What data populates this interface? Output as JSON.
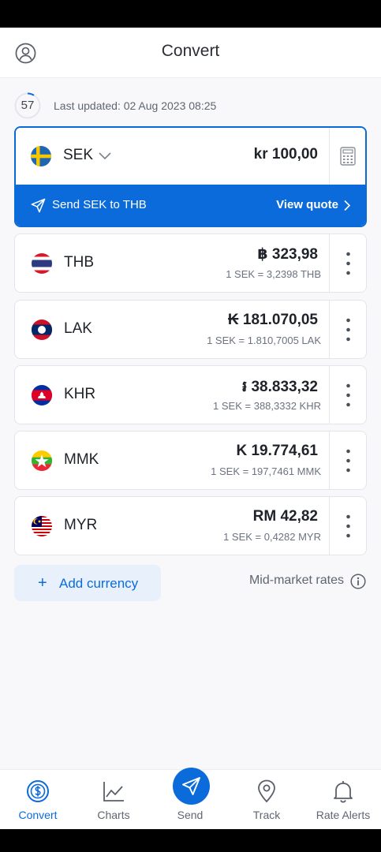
{
  "header": {
    "title": "Convert",
    "profile_icon": "user-circle-icon"
  },
  "status": {
    "timer": "57",
    "last_updated": "Last updated: 02 Aug 2023 08:25"
  },
  "base": {
    "code": "SEK",
    "amount": "kr 100,00",
    "send_text": "Send SEK to THB",
    "view_quote": "View quote"
  },
  "currencies": [
    {
      "code": "THB",
      "amount": "฿ 323,98",
      "rate": "1 SEK = 3,2398 THB"
    },
    {
      "code": "LAK",
      "amount": "₭ 181.070,05",
      "rate": "1 SEK = 1.810,7005 LAK"
    },
    {
      "code": "KHR",
      "amount": "៛ 38.833,32",
      "rate": "1 SEK = 388,3332 KHR"
    },
    {
      "code": "MMK",
      "amount": "K 19.774,61",
      "rate": "1 SEK = 197,7461 MMK"
    },
    {
      "code": "MYR",
      "amount": "RM 42,82",
      "rate": "1 SEK = 0,4282 MYR"
    }
  ],
  "actions": {
    "add_currency": "Add currency",
    "mid_market": "Mid-market rates"
  },
  "nav": [
    {
      "label": "Convert",
      "icon": "currency-icon",
      "active": true
    },
    {
      "label": "Charts",
      "icon": "chart-icon"
    },
    {
      "label": "Send",
      "icon": "send-icon"
    },
    {
      "label": "Track",
      "icon": "location-pin-icon"
    },
    {
      "label": "Rate Alerts",
      "icon": "bell-icon"
    }
  ],
  "colors": {
    "accent": "#0b6bdb",
    "background": "#f8f8fb"
  }
}
